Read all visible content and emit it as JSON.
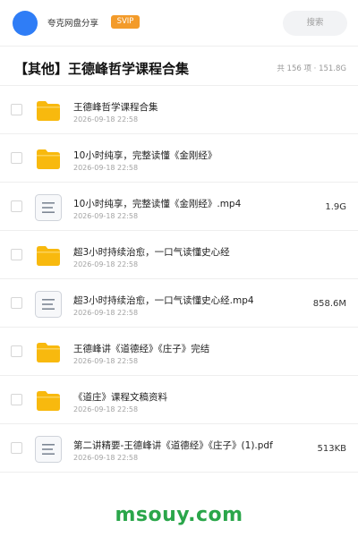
{
  "header": {
    "app_name": "夸克网盘分享",
    "badge": "SVIP",
    "search_placeholder": "搜索",
    "avatar_color": "#2f7df6",
    "badge_color": "#f39b2a"
  },
  "folder": {
    "title": "【其他】王德峰哲学课程合集",
    "summary": "共 156 项 · 151.8G"
  },
  "files": [
    {
      "type": "folder",
      "icon": "folder-icon",
      "name": "王德峰哲学课程合集",
      "date": "2026-09-18 22:58",
      "size": ""
    },
    {
      "type": "folder",
      "icon": "folder-icon",
      "name": "10小时纯享，完整读懂《金刚经》",
      "date": "2026-09-18 22:58",
      "size": ""
    },
    {
      "type": "file",
      "icon": "document-icon",
      "name": "10小时纯享，完整读懂《金刚经》.mp4",
      "date": "2026-09-18 22:58",
      "size": "1.9G"
    },
    {
      "type": "folder",
      "icon": "folder-icon",
      "name": "超3小时持续治愈，一口气读懂史心经",
      "date": "2026-09-18 22:58",
      "size": ""
    },
    {
      "type": "file",
      "icon": "document-icon",
      "name": "超3小时持续治愈，一口气读懂史心经.mp4",
      "date": "2026-09-18 22:58",
      "size": "858.6M"
    },
    {
      "type": "folder",
      "icon": "folder-icon",
      "name": "王德峰讲《道德经》《庄子》完结",
      "date": "2026-09-18 22:58",
      "size": ""
    },
    {
      "type": "folder",
      "icon": "folder-icon",
      "name": "《道庄》课程文稿资料",
      "date": "2026-09-18 22:58",
      "size": ""
    },
    {
      "type": "file",
      "icon": "document-icon",
      "name": "第二讲精要-王德峰讲《道德经》《庄子》(1).pdf",
      "date": "2026-09-18 22:58",
      "size": "513KB"
    }
  ],
  "footer": {
    "watermark": "msouy.com",
    "watermark_color": "#2aa64a"
  }
}
